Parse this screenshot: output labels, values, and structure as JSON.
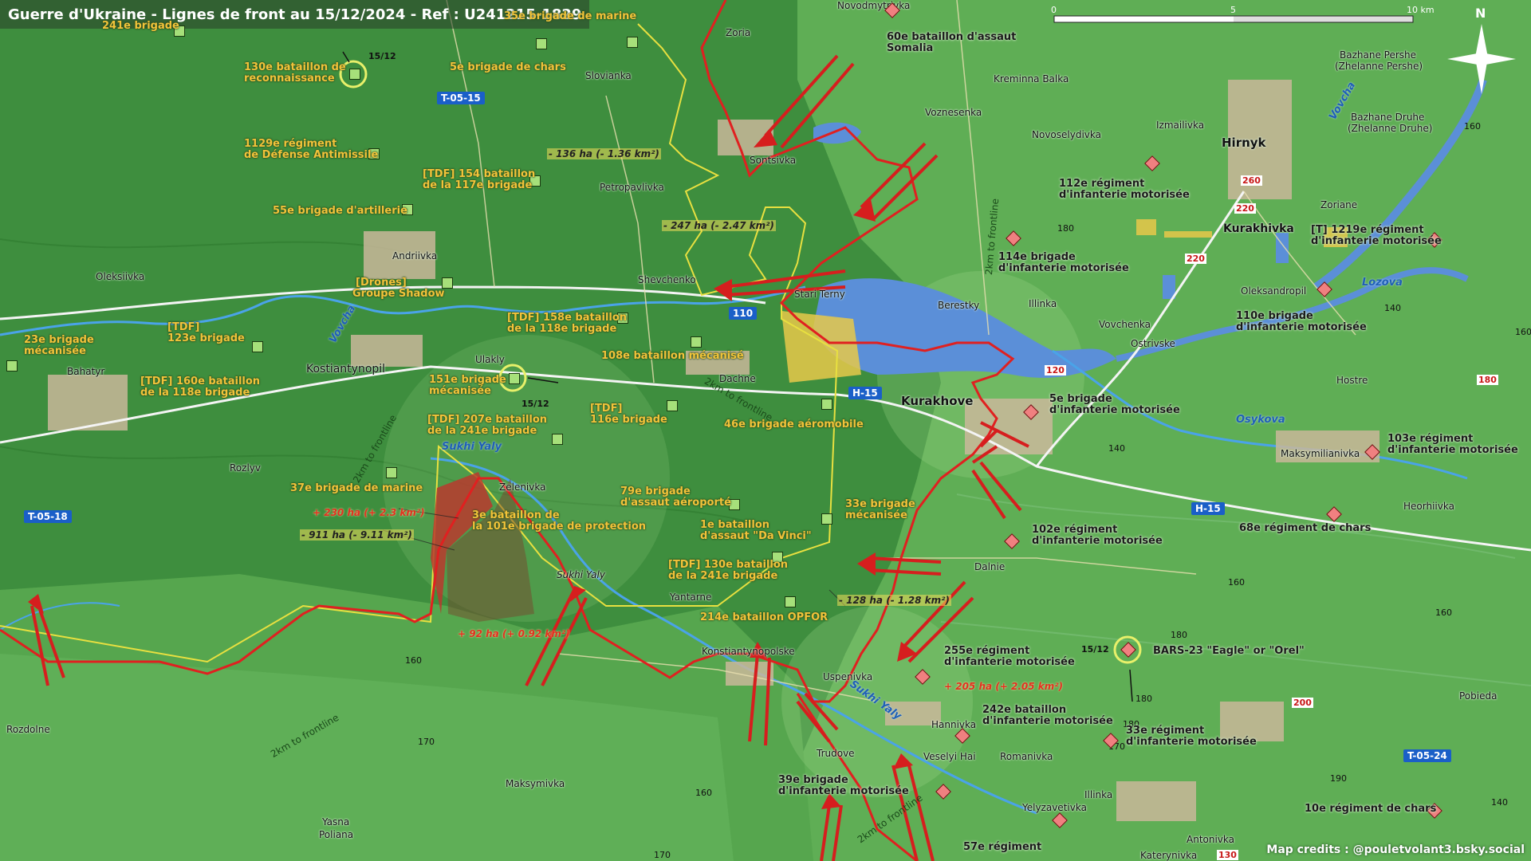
{
  "title": "Guerre d'Ukraine - Lignes de front au 15/12/2024 - Ref : U241215-1829",
  "credits": "Map credits : @pouletvolant3.bsky.social",
  "scale": {
    "t0": "0",
    "t5": "5",
    "t10": "10 km"
  },
  "north": "N",
  "roads": [
    "T-05-15",
    "T-05-18",
    "H-15",
    "H-15",
    "T-05-24",
    "110"
  ],
  "highway_numbers": [
    "260",
    "220",
    "220",
    "180",
    "200",
    "120",
    "130"
  ],
  "towns": {
    "novodmytrivka": "Novodmytrivka",
    "zoria": "Zoria",
    "slovianka": "Slovianka",
    "sontsivka": "Sontsivka",
    "petropavlivka": "Petropavlivka",
    "shevchenko": "Shevchenko",
    "andriivka": "Andriivka",
    "oleksiivka": "Oleksiivka",
    "bahatyr": "Bahatyr",
    "kostiantynopil": "Kostiantynopil",
    "ulakly": "Ulakly",
    "dachne": "Dachne",
    "stari_terny": "Stari Terny",
    "kurakhove": "Kurakhove",
    "berestky": "Berestky",
    "illinka": "Illinka",
    "kreminna_balka": "Kreminna Balka",
    "voznesenka": "Voznesenka",
    "novoselydivka": "Novoselydivka",
    "izmailivka": "Izmailivka",
    "hirnyk": "Hirnyk",
    "kurakhivka": "Kurakhivka",
    "zoriane": "Zoriane",
    "bazhane1": "Bazhane Pershe",
    "bazhane1_alt": "(Zhelanne Pershe)",
    "bazhane2": "Bazhane Druhe",
    "bazhane2_alt": "(Zhelanne Druhe)",
    "oleksandropil": "Oleksandropil",
    "vovchenka": "Vovchenka",
    "ostrivske": "Ostrivske",
    "hostre": "Hostre",
    "maksymilianivka": "Maksymilianivka",
    "heorhiivka": "Heorhiivka",
    "rozlyv": "Rozlyv",
    "zelenivka": "Zelenivka",
    "sukhi_yaly_town": "Sukhi Yaly",
    "yantarne": "Yantarne",
    "konstiantynopolske": "Konstiantynopolske",
    "dalnie": "Dalnie",
    "uspenivka": "Uspenivka",
    "hannivka": "Hannivka",
    "veselyi_hai": "Veselyi Hai",
    "romanivka": "Romanivka",
    "trudove": "Trudove",
    "rozdolne": "Rozdolne",
    "maksymivka": "Maksymivka",
    "yasna_poliana1": "Yasna",
    "yasna_poliana2": "Poliana",
    "yelyzavetivka": "Yelyzavetivka",
    "illinka2": "Illinka",
    "antonivka": "Antonivka",
    "katerynivka": "Katerynivka",
    "pobieda": "Pobieda"
  },
  "rivers": {
    "vovcha": "Vovcha",
    "vovcha2": "Vovcha",
    "sukhi_yaly": "Sukhi Yaly",
    "sukhi_yaly2": "Sukhi Yaly",
    "osykova": "Osykova",
    "lozova": "Lozova"
  },
  "distance_labels": [
    "2km to frontline",
    "2km to frontline",
    "2km to frontline",
    "2km to frontline",
    "2km to frontline"
  ],
  "elevations": [
    "160",
    "140",
    "160",
    "180",
    "140",
    "180",
    "160",
    "160",
    "170",
    "160",
    "180",
    "190",
    "160",
    "170",
    "170",
    "140",
    "180"
  ],
  "ua_units": {
    "u241": "241e brigade",
    "u35": "35e brigade de marine",
    "u130r1": "130e bataillon de",
    "u130r2": "reconnaissance",
    "u5c": "5e brigade de chars",
    "u1129a": "1129e régiment",
    "u1129b": "de Défense Antimissile",
    "u154a": "[TDF] 154 bataillon",
    "u154b": "de la 117e brigade",
    "u55": "55e brigade d'artillerie",
    "udrones1": "[Drones]",
    "udrones2": "Groupe Shadow",
    "u123a": "[TDF]",
    "u123b": "123e brigade",
    "u23a": "23e brigade",
    "u23b": "mécanisée",
    "u158a": "[TDF] 158e bataillon",
    "u158b": "de la 118e brigade",
    "u160a": "[TDF] 160e bataillon",
    "u160b": "de la 118e brigade",
    "u151a": "151e brigade",
    "u151b": "mécanisée",
    "u108": "108e bataillon mécanisé",
    "u207a": "[TDF] 207e bataillon",
    "u207b": "de la 241e brigade",
    "u116a": "[TDF]",
    "u116b": "116e brigade",
    "u46": "46e brigade aéromobile",
    "u37": "37e brigade de marine",
    "u3a": "3e bataillon de",
    "u3b": "la 101e brigade de protection",
    "u79a": "79e brigade",
    "u79b": "d'assaut aéroporté",
    "u33a": "33e brigade",
    "u33b": "mécanisée",
    "udv1": "1e bataillon",
    "udv2": "d'assaut \"Da Vinci\"",
    "u130a": "[TDF] 130e bataillon",
    "u130b": "de la 241e brigade",
    "u214": "214e bataillon OPFOR"
  },
  "ru_units": {
    "r60a": "60e bataillon d'assaut",
    "r60b": "Somalia",
    "r112a": "112e régiment",
    "r112b": "d'infanterie motorisée",
    "r114a": "114e brigade",
    "r114b": "d'infanterie motorisée",
    "r1219a": "[T] 1219e régiment",
    "r1219b": "d'infanterie motorisée",
    "r110a": "110e brigade",
    "r110b": "d'infanterie motorisée",
    "r5a": "5e brigade",
    "r5b": "d'infanterie motorisée",
    "r103a": "103e régiment",
    "r103b": "d'infanterie motorisée",
    "r68": "68e régiment de chars",
    "r102a": "102e régiment",
    "r102b": "d'infanterie motorisée",
    "r255a": "255e régiment",
    "r255b": "d'infanterie motorisée",
    "rbars": "BARS-23 \"Eagle\" or \"Orel\"",
    "r242a": "242e bataillon",
    "r242b": "d'infanterie motorisée",
    "r33a": "33e régiment",
    "r33b": "d'infanterie motorisée",
    "r39a": "39e brigade",
    "r39b": "d'infanterie motorisée",
    "r10": "10e régiment de chars",
    "r57": "57e régiment"
  },
  "dates": [
    "15/12",
    "15/12",
    "15/12"
  ],
  "area_changes": {
    "a136": "- 136 ha (- 1.36 km²)",
    "a247": "- 247 ha (- 2.47 km²)",
    "a230": "+ 230 ha (+ 2.3 km²)",
    "a911": "- 911 ha (- 9.11 km²)",
    "a92": "+ 92 ha (+ 0.92 km²)",
    "a128": "- 128 ha (- 1.28 km²)",
    "a205": "+ 205 ha (+ 2.05 km²)"
  },
  "colors": {
    "ua_zone": "#3f8f3f",
    "ru_zone": "#76c36a",
    "front_line": "#e02020",
    "water": "#5b8fd8",
    "ua_label": "#f2c33a"
  }
}
